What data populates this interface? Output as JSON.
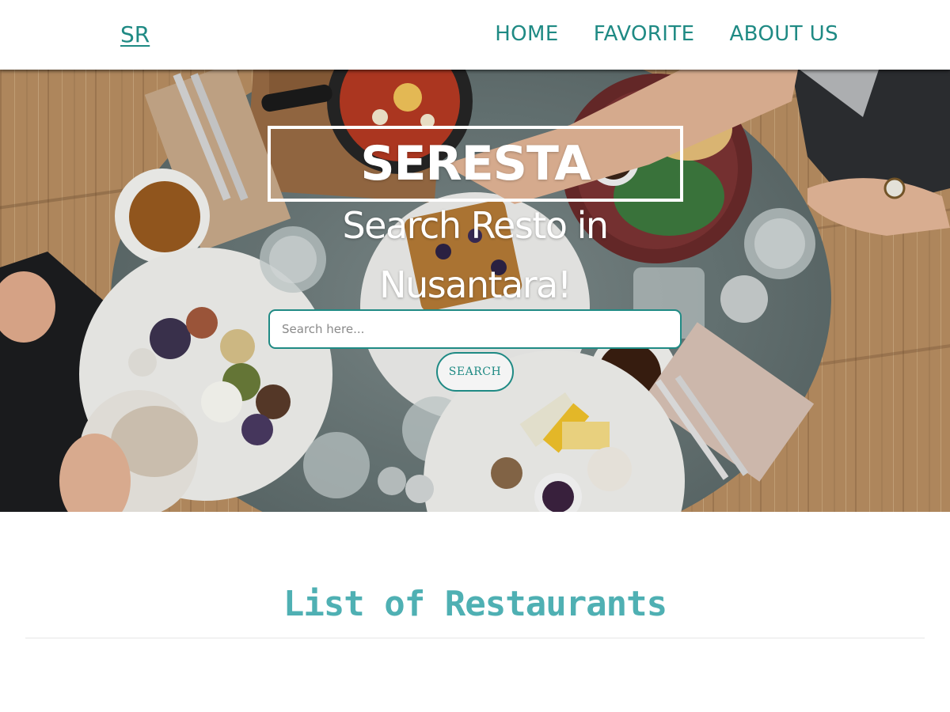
{
  "header": {
    "brand": "SR",
    "nav": [
      {
        "label": "HOME"
      },
      {
        "label": "FAVORITE"
      },
      {
        "label": "ABOUT US"
      }
    ]
  },
  "hero": {
    "title": "SERESTA",
    "subtitle_line1": "Search Resto in",
    "subtitle_line2": "Nusantara!",
    "search": {
      "placeholder": "Search here...",
      "value": "",
      "button_label": "SEARCH"
    }
  },
  "main": {
    "section_title": "List of Restaurants"
  },
  "colors": {
    "accent": "#1f8a84",
    "section_title": "#4fb0b3",
    "header_bg": "#ffffff"
  },
  "icons": [
    "hero-food-photo"
  ]
}
